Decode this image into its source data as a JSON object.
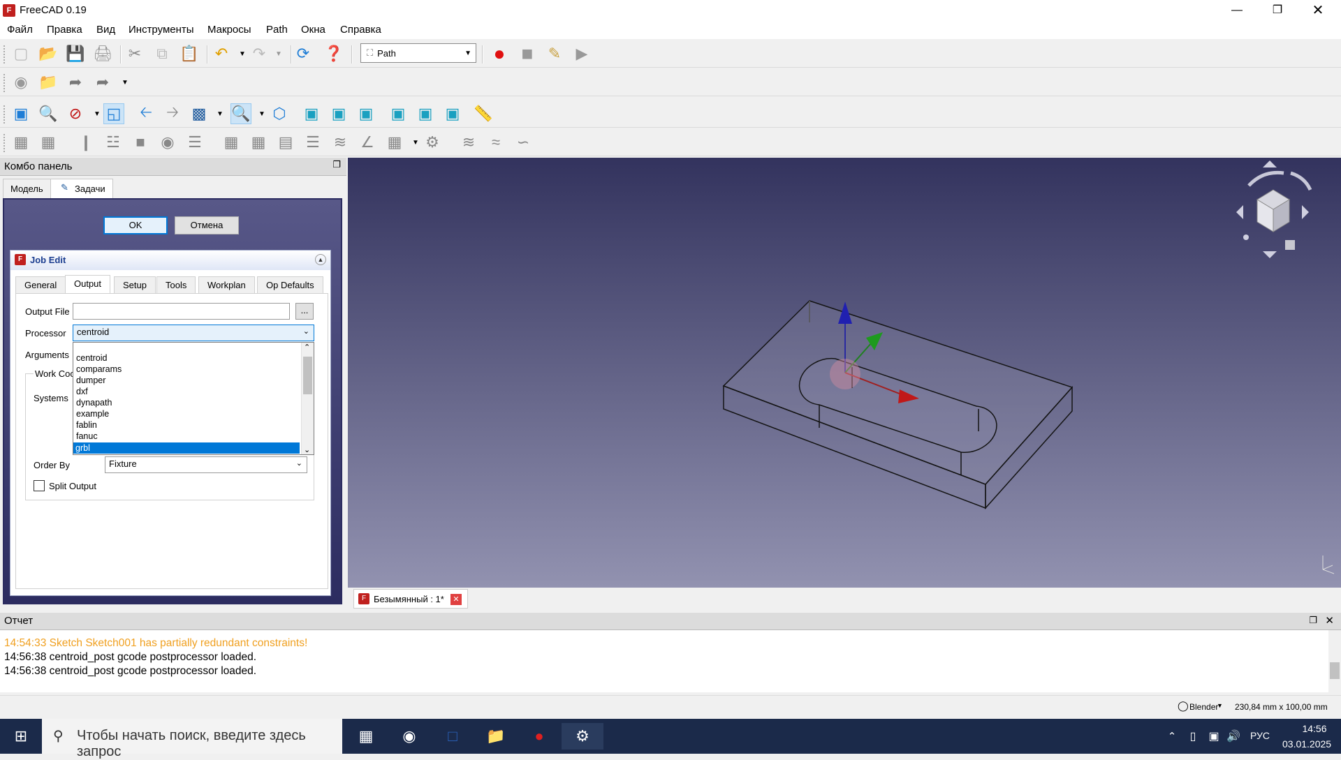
{
  "window": {
    "title": "FreeCAD 0.19",
    "icon_text": "F"
  },
  "menu": [
    "Файл",
    "Правка",
    "Вид",
    "Инструменты",
    "Макросы",
    "Path",
    "Окна",
    "Справка"
  ],
  "toolbar": {
    "workbench": "Path"
  },
  "combo": {
    "title": "Комбо панель",
    "tabs": [
      "Модель",
      "Задачи"
    ],
    "ok": "OK",
    "cancel": "Отмена",
    "job_edit": {
      "title": "Job Edit",
      "tabs": [
        "General",
        "Output",
        "Setup",
        "Tools",
        "Workplan",
        "Op Defaults"
      ],
      "output_file_label": "Output File",
      "output_file_value": "",
      "browse": "...",
      "processor_label": "Processor",
      "processor_value": "centroid",
      "arguments_label": "Arguments",
      "work_coord_label": "Work Coor",
      "systems_label": "Systems",
      "order_by_label": "Order By",
      "order_by_value": "Fixture",
      "split_output_label": "Split Output",
      "dropdown_options": [
        "centroid",
        "comparams",
        "dumper",
        "dxf",
        "dynapath",
        "example",
        "fablin",
        "fanuc",
        "grbl"
      ],
      "selected_option": "grbl"
    }
  },
  "document_tab": "Безымянный : 1*",
  "report": {
    "title": "Отчет",
    "lines": [
      {
        "text": "14:54:33  Sketch Sketch001 has partially redundant constraints!",
        "color": "#f0a020"
      },
      {
        "text": "14:56:38  centroid_post gcode postprocessor loaded.",
        "color": "#000000"
      },
      {
        "text": "14:56:38  centroid_post gcode postprocessor loaded.",
        "color": "#000000"
      }
    ]
  },
  "status": {
    "nav_style": "Blender",
    "dimensions": "230,84 mm x 100,00 mm"
  },
  "taskbar": {
    "search_placeholder": "Чтобы начать поиск, введите здесь запрос",
    "lang": "РУС",
    "time": "14:56",
    "date": "03.01.2025"
  },
  "colors": {
    "accent": "#0078d7",
    "viewport_top": "#33335e",
    "viewport_bottom": "#9292b0",
    "warning": "#f0a020"
  }
}
